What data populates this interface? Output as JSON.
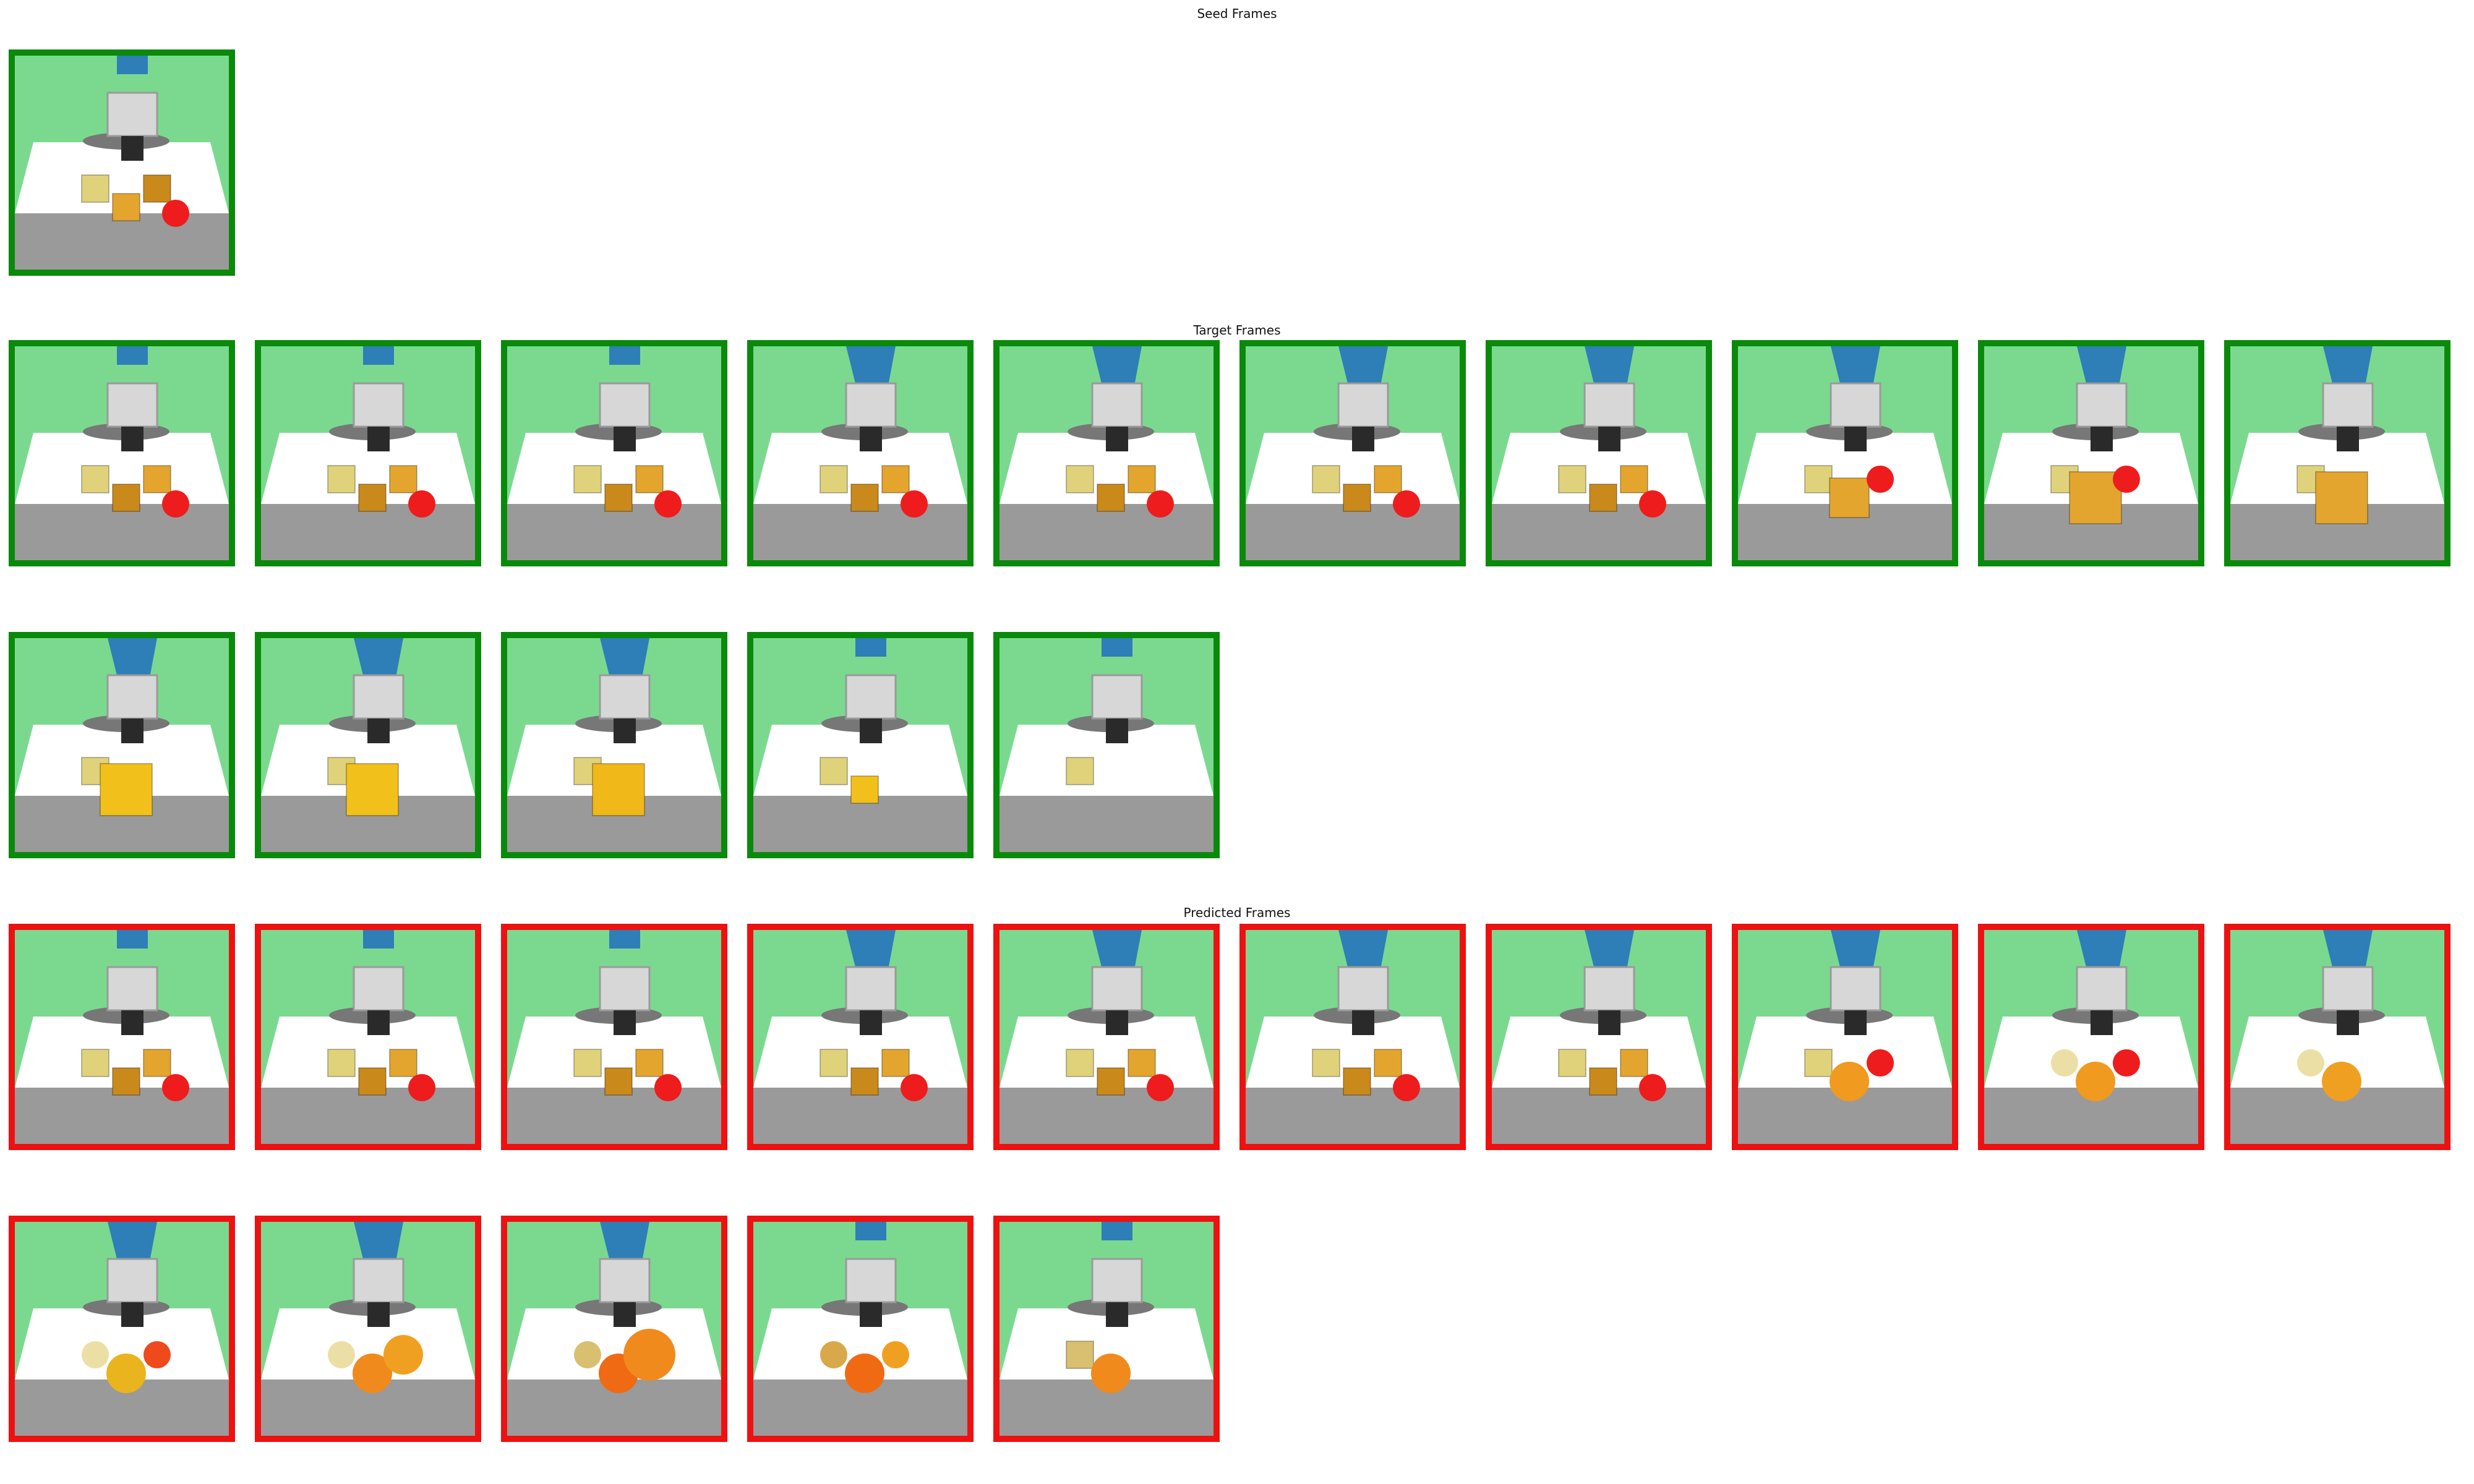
{
  "sections": {
    "seed": {
      "title": "Seed Frames",
      "frames": [
        {
          "robot": "gray",
          "items": [
            [
              "cube",
              "#e0d27a",
              "small"
            ],
            [
              "cube",
              "#e3a52d",
              "small"
            ],
            [
              "cube",
              "#c98a1b",
              "small"
            ],
            [
              "ball",
              "#ee1c1c",
              "small"
            ]
          ]
        }
      ]
    },
    "target": {
      "title": "Target Frames",
      "frames": [
        {
          "robot": "gray",
          "items": [
            [
              "cube",
              "#e0d27a",
              "small"
            ],
            [
              "cube",
              "#c98a1b",
              "small"
            ],
            [
              "cube",
              "#e3a52d",
              "small"
            ],
            [
              "ball",
              "#ee1c1c",
              "small"
            ]
          ]
        },
        {
          "robot": "gray",
          "items": [
            [
              "cube",
              "#e0d27a",
              "small"
            ],
            [
              "cube",
              "#c98a1b",
              "small"
            ],
            [
              "cube",
              "#e3a52d",
              "small"
            ],
            [
              "ball",
              "#ee1c1c",
              "small"
            ]
          ]
        },
        {
          "robot": "gray",
          "items": [
            [
              "cube",
              "#e0d27a",
              "small"
            ],
            [
              "cube",
              "#c98a1b",
              "small"
            ],
            [
              "cube",
              "#e3a52d",
              "small"
            ],
            [
              "ball",
              "#ee1c1c",
              "small"
            ]
          ]
        },
        {
          "robot": "blue",
          "items": [
            [
              "cube",
              "#e0d27a",
              "small"
            ],
            [
              "cube",
              "#c98a1b",
              "small"
            ],
            [
              "cube",
              "#e3a52d",
              "small"
            ],
            [
              "ball",
              "#ee1c1c",
              "small"
            ]
          ]
        },
        {
          "robot": "blue",
          "items": [
            [
              "cube",
              "#e0d27a",
              "small"
            ],
            [
              "cube",
              "#c98a1b",
              "small"
            ],
            [
              "cube",
              "#e3a52d",
              "small"
            ],
            [
              "ball",
              "#ee1c1c",
              "small"
            ]
          ]
        },
        {
          "robot": "blue",
          "items": [
            [
              "cube",
              "#e0d27a",
              "small"
            ],
            [
              "cube",
              "#c98a1b",
              "small"
            ],
            [
              "cube",
              "#e3a52d",
              "small"
            ],
            [
              "ball",
              "#ee1c1c",
              "small"
            ]
          ]
        },
        {
          "robot": "blue",
          "items": [
            [
              "cube",
              "#e0d27a",
              "small"
            ],
            [
              "cube",
              "#c98a1b",
              "small"
            ],
            [
              "cube",
              "#e3a52d",
              "small"
            ],
            [
              "ball",
              "#ee1c1c",
              "small"
            ]
          ]
        },
        {
          "robot": "blue",
          "items": [
            [
              "cube",
              "#e0d27a",
              "small"
            ],
            [
              "cube",
              "#e3a52d",
              "medium"
            ],
            [
              "ball",
              "#ee1c1c",
              "small"
            ]
          ]
        },
        {
          "robot": "blue",
          "items": [
            [
              "cube",
              "#e0d27a",
              "small"
            ],
            [
              "cube",
              "#e3a52d",
              "large"
            ],
            [
              "ball",
              "#ee1c1c",
              "small"
            ]
          ]
        },
        {
          "robot": "blue",
          "items": [
            [
              "cube",
              "#e0d27a",
              "small"
            ],
            [
              "cube",
              "#e3a52d",
              "large"
            ]
          ]
        },
        {
          "robot": "blue",
          "items": [
            [
              "cube",
              "#e0d27a",
              "small"
            ],
            [
              "cube",
              "#f2c01a",
              "large"
            ]
          ]
        },
        {
          "robot": "blue",
          "items": [
            [
              "cube",
              "#e0d27a",
              "small"
            ],
            [
              "cube",
              "#f2c01a",
              "large"
            ]
          ]
        },
        {
          "robot": "blue",
          "items": [
            [
              "cube",
              "#e0d27a",
              "small"
            ],
            [
              "cube",
              "#f0b818",
              "large"
            ]
          ]
        },
        {
          "robot": "gray",
          "items": [
            [
              "cube",
              "#e0d27a",
              "small"
            ],
            [
              "cube",
              "#f2c01a",
              "small"
            ]
          ]
        },
        {
          "robot": "gray",
          "items": [
            [
              "cube",
              "#e0d27a",
              "small"
            ]
          ]
        }
      ]
    },
    "predicted": {
      "title": "Predicted Frames",
      "frames": [
        {
          "robot": "gray",
          "items": [
            [
              "cube",
              "#e0d27a",
              "small"
            ],
            [
              "cube",
              "#c98a1b",
              "small"
            ],
            [
              "cube",
              "#e3a52d",
              "small"
            ],
            [
              "ball",
              "#ee1c1c",
              "small"
            ]
          ]
        },
        {
          "robot": "gray",
          "items": [
            [
              "cube",
              "#e0d27a",
              "small"
            ],
            [
              "cube",
              "#c98a1b",
              "small"
            ],
            [
              "cube",
              "#e3a52d",
              "small"
            ],
            [
              "ball",
              "#ee1c1c",
              "small"
            ]
          ]
        },
        {
          "robot": "gray",
          "items": [
            [
              "cube",
              "#e0d27a",
              "small"
            ],
            [
              "cube",
              "#c98a1b",
              "small"
            ],
            [
              "cube",
              "#e3a52d",
              "small"
            ],
            [
              "ball",
              "#ee1c1c",
              "small"
            ]
          ]
        },
        {
          "robot": "blue",
          "items": [
            [
              "cube",
              "#e0d27a",
              "small"
            ],
            [
              "cube",
              "#c98a1b",
              "small"
            ],
            [
              "cube",
              "#e3a52d",
              "small"
            ],
            [
              "ball",
              "#ee1c1c",
              "small"
            ]
          ]
        },
        {
          "robot": "blue",
          "items": [
            [
              "cube",
              "#e0d27a",
              "small"
            ],
            [
              "cube",
              "#c98a1b",
              "small"
            ],
            [
              "cube",
              "#e3a52d",
              "small"
            ],
            [
              "ball",
              "#ee1c1c",
              "small"
            ]
          ]
        },
        {
          "robot": "blue",
          "items": [
            [
              "cube",
              "#e0d27a",
              "small"
            ],
            [
              "cube",
              "#c98a1b",
              "small"
            ],
            [
              "cube",
              "#e3a52d",
              "small"
            ],
            [
              "ball",
              "#ee1c1c",
              "small"
            ]
          ]
        },
        {
          "robot": "blue",
          "items": [
            [
              "cube",
              "#e0d27a",
              "small"
            ],
            [
              "cube",
              "#c98a1b",
              "small"
            ],
            [
              "cube",
              "#e3a52d",
              "small"
            ],
            [
              "ball",
              "#ee1c1c",
              "small"
            ]
          ]
        },
        {
          "robot": "blue",
          "items": [
            [
              "cube",
              "#e0d27a",
              "small"
            ],
            [
              "ball",
              "#f09a20",
              "medium"
            ],
            [
              "ball",
              "#ee1c1c",
              "small"
            ]
          ]
        },
        {
          "robot": "blue",
          "items": [
            [
              "ball",
              "#ecdfa6",
              "small"
            ],
            [
              "ball",
              "#f09a20",
              "medium"
            ],
            [
              "ball",
              "#ee1c1c",
              "small"
            ]
          ]
        },
        {
          "robot": "blue",
          "items": [
            [
              "ball",
              "#ecdfa6",
              "small"
            ],
            [
              "ball",
              "#f0a020",
              "medium"
            ]
          ]
        },
        {
          "robot": "blue",
          "items": [
            [
              "ball",
              "#ecdfa6",
              "small"
            ],
            [
              "ball",
              "#e9b41e",
              "medium"
            ],
            [
              "ball",
              "#ee4a1c",
              "small"
            ]
          ]
        },
        {
          "robot": "blue",
          "items": [
            [
              "ball",
              "#ecdfa6",
              "small"
            ],
            [
              "ball",
              "#f08a1c",
              "medium"
            ],
            [
              "ball",
              "#f0a020",
              "medium"
            ]
          ]
        },
        {
          "robot": "blue",
          "items": [
            [
              "ball",
              "#d8c070",
              "small"
            ],
            [
              "ball",
              "#f06a14",
              "medium"
            ],
            [
              "ball",
              "#f08a1c",
              "large"
            ]
          ]
        },
        {
          "robot": "gray",
          "items": [
            [
              "ball",
              "#d8a84a",
              "small"
            ],
            [
              "ball",
              "#f06a14",
              "medium"
            ],
            [
              "ball",
              "#f0a020",
              "small"
            ]
          ]
        },
        {
          "robot": "gray",
          "items": [
            [
              "cube",
              "#d8c070",
              "small"
            ],
            [
              "ball",
              "#f08a1c",
              "medium"
            ]
          ]
        }
      ]
    }
  }
}
